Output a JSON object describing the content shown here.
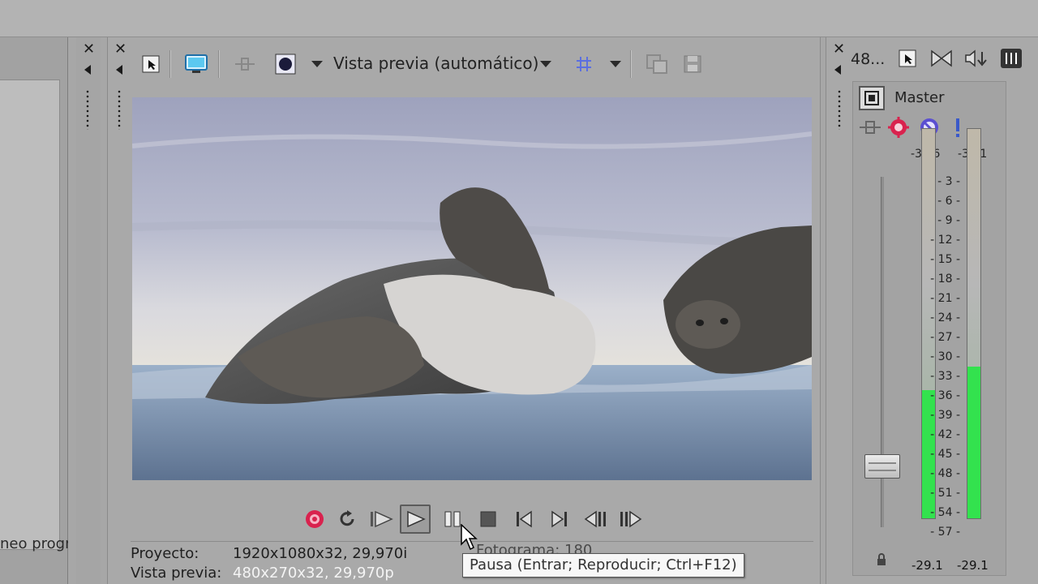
{
  "left_panel": {
    "truncated_label": "neo progr"
  },
  "preview": {
    "mode_label": "Vista previa (automático)",
    "info": {
      "project_label": "Proyecto:",
      "project_value": "1920x1080x32, 29,970i",
      "preview_label": "Vista previa:",
      "preview_value": "480x270x32, 29,970p",
      "frame_label": "Fotograma:",
      "frame_value": "180"
    },
    "tooltip": "Pausa (Entrar; Reproducir; Ctrl+F12)"
  },
  "master": {
    "header_value": "48...",
    "bus_label": "Master",
    "peak_left": "-36.6",
    "peak_right": "-32.1",
    "level_left": "-29.1",
    "level_right": "-29.1",
    "scale": [
      "3",
      "6",
      "9",
      "12",
      "15",
      "18",
      "21",
      "24",
      "27",
      "30",
      "33",
      "36",
      "39",
      "42",
      "45",
      "48",
      "51",
      "54",
      "57"
    ],
    "meter_fill_left": 0.33,
    "meter_fill_right": 0.39
  },
  "colors": {
    "meter_green": "#33e24e",
    "record_red": "#d9224e",
    "grid_blue": "#5b6fe0"
  }
}
